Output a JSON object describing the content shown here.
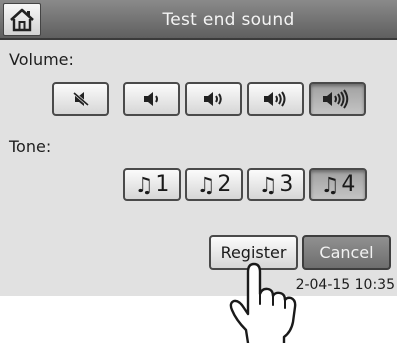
{
  "header": {
    "title": "Test end sound",
    "home_icon": "home-icon"
  },
  "volume": {
    "label": "Volume:",
    "options": [
      {
        "icon": "speaker-muted-icon",
        "level": 0
      },
      {
        "icon": "speaker-level-1-icon",
        "level": 1
      },
      {
        "icon": "speaker-level-2-icon",
        "level": 2
      },
      {
        "icon": "speaker-level-3-icon",
        "level": 3
      },
      {
        "icon": "speaker-level-4-icon",
        "level": 4
      }
    ],
    "selected_level": 4
  },
  "tone": {
    "label": "Tone:",
    "note_glyph": "♫",
    "options": [
      "1",
      "2",
      "3",
      "4"
    ],
    "selected": "4"
  },
  "actions": {
    "register_label": "Register",
    "cancel_label": "Cancel"
  },
  "status": {
    "timestamp": "2-04-15 10:35"
  },
  "overlay": {
    "pointer_icon": "pointing-hand-icon"
  },
  "colors": {
    "titlebar": "#6f6f6f",
    "screen_bg": "#e1e1e1",
    "selected_button": "#a8a8a8",
    "cancel_button": "#7e7e7e"
  }
}
